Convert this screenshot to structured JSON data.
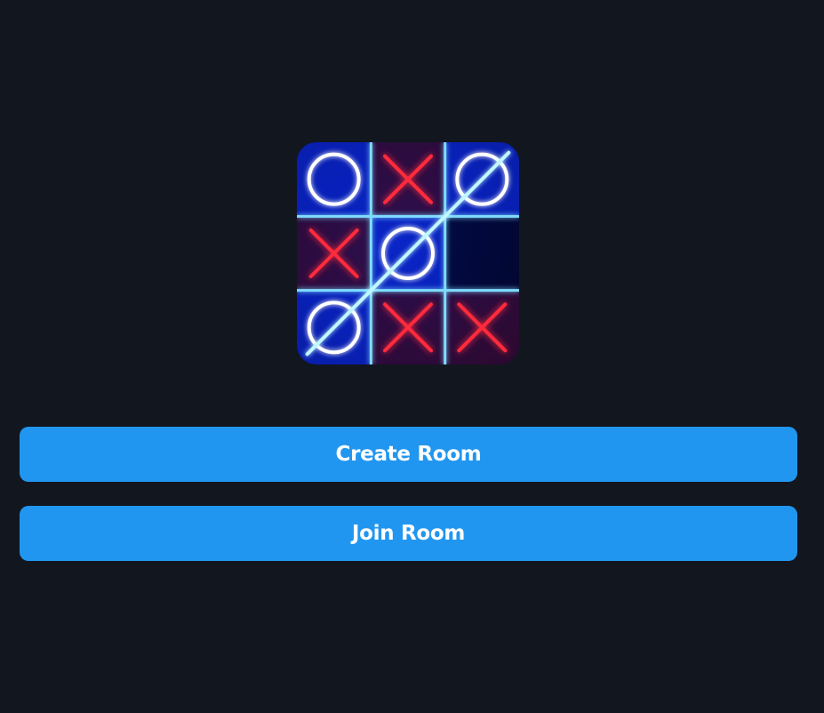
{
  "logo": {
    "icon": "tic-tac-toe-neon-icon",
    "board": [
      [
        "O",
        "X",
        "O"
      ],
      [
        "X",
        "O",
        ""
      ],
      [
        "O",
        "X",
        "X"
      ]
    ],
    "colors": {
      "background": "#0617a8",
      "grid": "#7fdcff",
      "o_mark": "#ffffff",
      "x_mark": "#ff2a3a",
      "win_line": "#bff6ff"
    }
  },
  "buttons": {
    "create_room": "Create Room",
    "join_room": "Join Room"
  },
  "colors": {
    "page_background": "#12161e",
    "button_background": "#2196f0",
    "button_text": "#ffffff"
  }
}
